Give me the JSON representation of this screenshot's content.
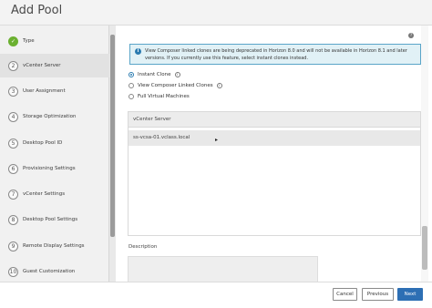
{
  "window": {
    "title": "Add Pool"
  },
  "sidebar": {
    "steps": [
      {
        "number": "✓",
        "label": "Type",
        "state": "done"
      },
      {
        "number": "2",
        "label": "vCenter Server",
        "state": "active"
      },
      {
        "number": "3",
        "label": "User Assignment",
        "state": "pending"
      },
      {
        "number": "4",
        "label": "Storage Optimization",
        "state": "pending"
      },
      {
        "number": "5",
        "label": "Desktop Pool ID",
        "state": "pending"
      },
      {
        "number": "6",
        "label": "Provisioning Settings",
        "state": "pending"
      },
      {
        "number": "7",
        "label": "vCenter Settings",
        "state": "pending"
      },
      {
        "number": "8",
        "label": "Desktop Pool Settings",
        "state": "pending"
      },
      {
        "number": "9",
        "label": "Remote Display Settings",
        "state": "pending"
      },
      {
        "number": "10",
        "label": "Guest Customization",
        "state": "pending"
      }
    ]
  },
  "info_banner": {
    "icon": "info-icon",
    "text": "View Composer linked clones are being deprecated in Horizon 8.0 and will not be available in Horizon 8.1 and later versions. If you currently use this feature, select instant clones instead."
  },
  "help_icon": "help-icon",
  "clone_options": {
    "selected": "Instant Clone",
    "options": [
      {
        "label": "Instant Clone",
        "checked": true,
        "info": true
      },
      {
        "label": "View Composer Linked Clones",
        "checked": false,
        "info": true
      },
      {
        "label": "Full Virtual Machines",
        "checked": false,
        "info": false
      }
    ]
  },
  "vcenter_table": {
    "header": "vCenter Server",
    "rows": [
      "ss-vcsa-01.vclass.local"
    ]
  },
  "description": {
    "label": "Description",
    "value": ""
  },
  "footer": {
    "cancel_label": "Cancel",
    "previous_label": "Previous",
    "next_label": "Next"
  },
  "colors": {
    "done_step": "#6bb030",
    "info_border": "#5aa5c8",
    "info_bg": "#e1f1f6",
    "primary_button": "#2d6fb4"
  }
}
